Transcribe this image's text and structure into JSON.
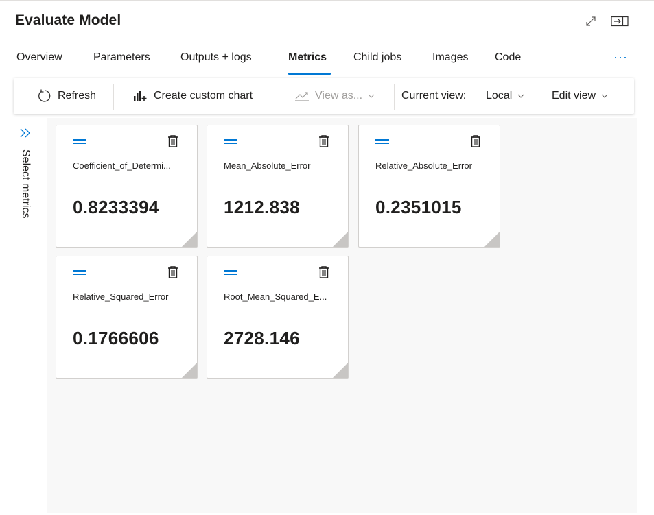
{
  "header": {
    "title": "Evaluate Model"
  },
  "tabs": [
    {
      "label": "Overview"
    },
    {
      "label": "Parameters"
    },
    {
      "label": "Outputs + logs"
    },
    {
      "label": "Metrics"
    },
    {
      "label": "Child jobs"
    },
    {
      "label": "Images"
    },
    {
      "label": "Code"
    }
  ],
  "active_tab": "Metrics",
  "more_label": "···",
  "toolbar": {
    "refresh_label": "Refresh",
    "create_chart_label": "Create custom chart",
    "view_as_label": "View as...",
    "current_view_label": "Current view:",
    "current_view_value": "Local",
    "edit_view_label": "Edit view"
  },
  "side_panel": {
    "label": "Select metrics"
  },
  "metrics": [
    {
      "name": "Coefficient_of_Determi...",
      "value": "0.8233394"
    },
    {
      "name": "Mean_Absolute_Error",
      "value": "1212.838"
    },
    {
      "name": "Relative_Absolute_Error",
      "value": "0.2351015"
    },
    {
      "name": "Relative_Squared_Error",
      "value": "0.1766606"
    },
    {
      "name": "Root_Mean_Squared_E...",
      "value": "2728.146"
    }
  ],
  "colors": {
    "accent": "#0078d4",
    "background": "#f8f8f8",
    "disabled": "#a19f9d"
  },
  "icons": {
    "expand": "expand-icon",
    "panel": "panel-icon",
    "refresh": "refresh-icon",
    "chart": "chart-add-icon",
    "view_as": "line-chart-icon",
    "trash": "trash-icon",
    "drag": "drag-handle-icon",
    "side": "double-chevron-right-icon"
  }
}
